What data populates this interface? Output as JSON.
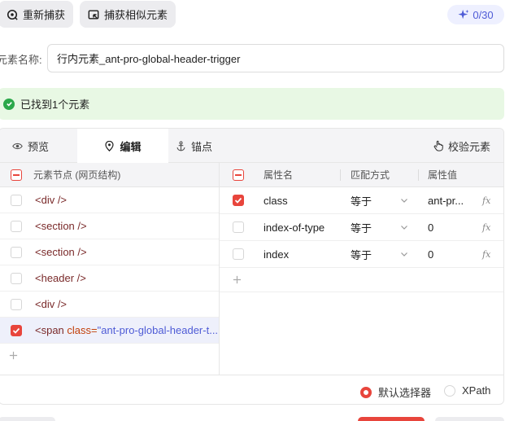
{
  "toolbar": {
    "recapture_label": "重新捕获",
    "capture_similar_label": "捕获相似元素",
    "counter": "0/30"
  },
  "element_name": {
    "label": "元素名称:",
    "value": "行内元素_ant-pro-global-header-trigger"
  },
  "alert": {
    "text": "已找到1个元素"
  },
  "tabs": [
    {
      "label": "预览"
    },
    {
      "label": "编辑"
    },
    {
      "label": "锚点"
    }
  ],
  "verify_label": "校验元素",
  "node_header": "元素节点 (网页结构)",
  "nodes": [
    {
      "text": "<div />",
      "checked": false
    },
    {
      "text": "<section />",
      "checked": false
    },
    {
      "text": "<section />",
      "checked": false
    },
    {
      "text": "<header />",
      "checked": false
    },
    {
      "text": "<div />",
      "checked": false
    },
    {
      "tag_open": "<span ",
      "attr": "class=",
      "value": "\"ant-pro-global-header-t...",
      "checked": true
    }
  ],
  "prop_headers": {
    "name": "属性名",
    "match": "匹配方式",
    "value": "属性值"
  },
  "props": [
    {
      "name": "class",
      "match": "等于",
      "value": "ant-pr...",
      "fx": "fx",
      "checked": true
    },
    {
      "name": "index-of-type",
      "match": "等于",
      "value": "0",
      "fx": "fx",
      "checked": false
    },
    {
      "name": "index",
      "match": "等于",
      "value": "0",
      "fx": "fx",
      "checked": false
    }
  ],
  "selector_options": {
    "default": "默认选择器",
    "xpath": "XPath"
  },
  "colors": {
    "accent": "#e8453c",
    "success": "#2ba84a",
    "link": "#4e5bd6"
  }
}
